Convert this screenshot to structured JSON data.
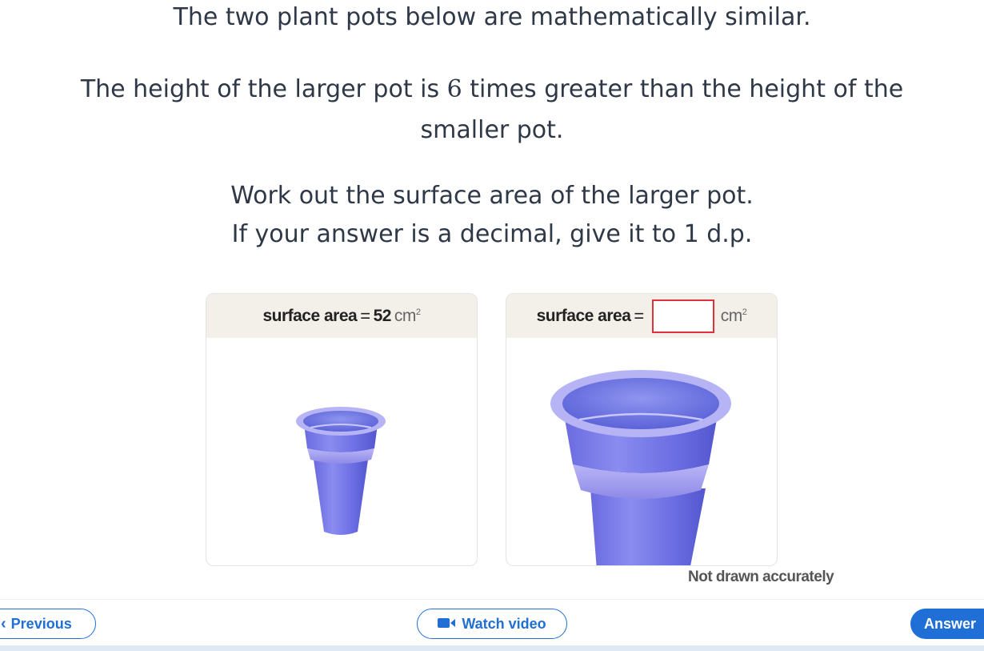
{
  "question": {
    "line1": "The two plant pots below are mathematically similar.",
    "line2_pre": "The height of the larger pot is ",
    "line2_num": "6",
    "line2_post": " times greater than the height of the",
    "line3": "smaller pot.",
    "line4": "Work out the surface area of the larger pot.",
    "line5": "If your answer is a decimal, give it to 1 d.p."
  },
  "small_pot": {
    "label": "surface area",
    "equals": "=",
    "value": "52",
    "unit": "cm",
    "unit_power": "2"
  },
  "large_pot": {
    "label": "surface area",
    "equals": "=",
    "answer_value": "",
    "unit": "cm",
    "unit_power": "2"
  },
  "note": "Not drawn accurately",
  "nav": {
    "previous_label": "Previous",
    "watch_label": "Watch video",
    "answer_label": "Answer"
  },
  "colors": {
    "accent": "#1f6fd6",
    "pot": "#7b7be8",
    "answer_border": "#e0303a"
  },
  "icons": {
    "previous": "chevron-left-icon",
    "watch": "video-camera-icon"
  }
}
